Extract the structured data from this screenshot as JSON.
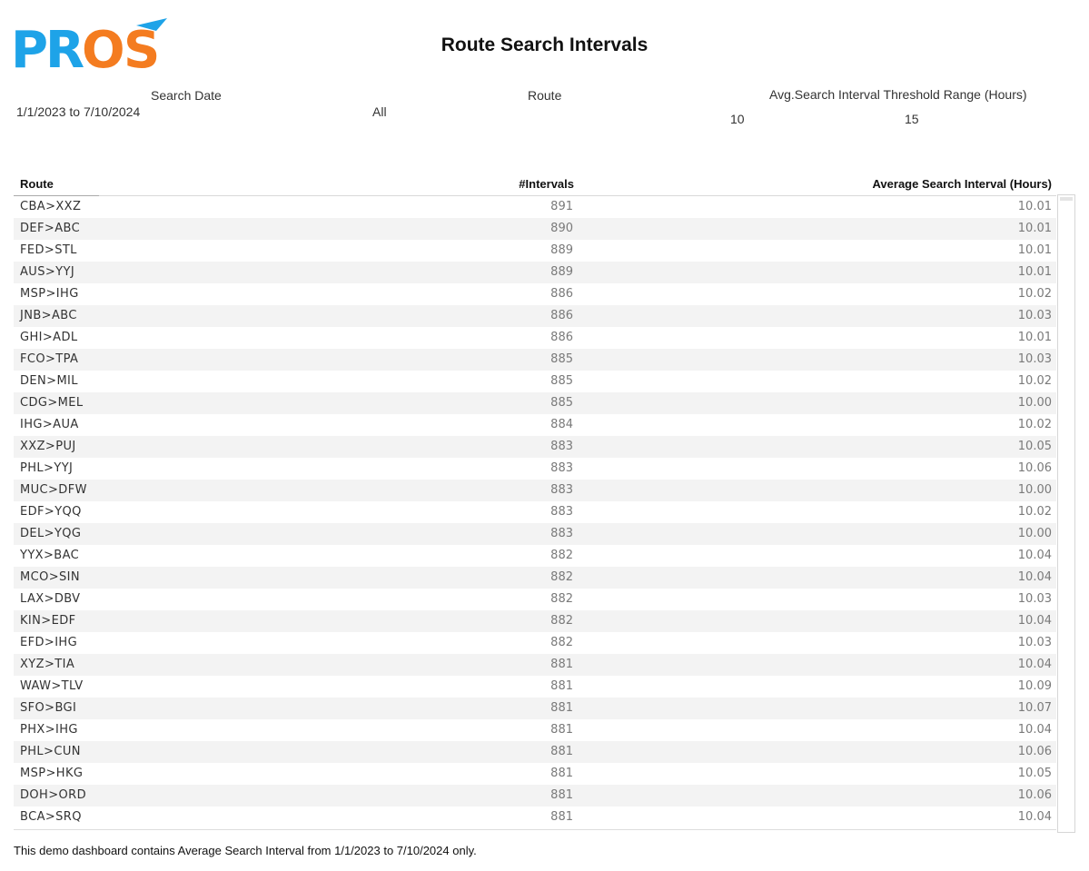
{
  "logo": {
    "text": "PROS",
    "colors": {
      "blue": "#1ea3e8",
      "orange": "#f47c20"
    }
  },
  "title": "Route Search Intervals",
  "filters": {
    "search_date": {
      "label": "Search Date",
      "value": "1/1/2023 to 7/10/2024"
    },
    "route": {
      "label": "Route",
      "value": "All"
    },
    "threshold": {
      "label": "Avg.Search Interval Threshold Range (Hours)",
      "min": "10",
      "max": "15"
    }
  },
  "table": {
    "columns": {
      "route": "Route",
      "intervals": "#Intervals",
      "avg": "Average Search Interval (Hours)"
    },
    "rows": [
      {
        "route": "CBA>XXZ",
        "intervals": "891",
        "avg": "10.01"
      },
      {
        "route": "DEF>ABC",
        "intervals": "890",
        "avg": "10.01"
      },
      {
        "route": "FED>STL",
        "intervals": "889",
        "avg": "10.01"
      },
      {
        "route": "AUS>YYJ",
        "intervals": "889",
        "avg": "10.01"
      },
      {
        "route": "MSP>IHG",
        "intervals": "886",
        "avg": "10.02"
      },
      {
        "route": "JNB>ABC",
        "intervals": "886",
        "avg": "10.03"
      },
      {
        "route": "GHI>ADL",
        "intervals": "886",
        "avg": "10.01"
      },
      {
        "route": "FCO>TPA",
        "intervals": "885",
        "avg": "10.03"
      },
      {
        "route": "DEN>MIL",
        "intervals": "885",
        "avg": "10.02"
      },
      {
        "route": "CDG>MEL",
        "intervals": "885",
        "avg": "10.00"
      },
      {
        "route": "IHG>AUA",
        "intervals": "884",
        "avg": "10.02"
      },
      {
        "route": "XXZ>PUJ",
        "intervals": "883",
        "avg": "10.05"
      },
      {
        "route": "PHL>YYJ",
        "intervals": "883",
        "avg": "10.06"
      },
      {
        "route": "MUC>DFW",
        "intervals": "883",
        "avg": "10.00"
      },
      {
        "route": "EDF>YQQ",
        "intervals": "883",
        "avg": "10.02"
      },
      {
        "route": "DEL>YQG",
        "intervals": "883",
        "avg": "10.00"
      },
      {
        "route": "YYX>BAC",
        "intervals": "882",
        "avg": "10.04"
      },
      {
        "route": "MCO>SIN",
        "intervals": "882",
        "avg": "10.04"
      },
      {
        "route": "LAX>DBV",
        "intervals": "882",
        "avg": "10.03"
      },
      {
        "route": "KIN>EDF",
        "intervals": "882",
        "avg": "10.04"
      },
      {
        "route": "EFD>IHG",
        "intervals": "882",
        "avg": "10.03"
      },
      {
        "route": "XYZ>TIA",
        "intervals": "881",
        "avg": "10.04"
      },
      {
        "route": "WAW>TLV",
        "intervals": "881",
        "avg": "10.09"
      },
      {
        "route": "SFO>BGI",
        "intervals": "881",
        "avg": "10.07"
      },
      {
        "route": "PHX>IHG",
        "intervals": "881",
        "avg": "10.04"
      },
      {
        "route": "PHL>CUN",
        "intervals": "881",
        "avg": "10.06"
      },
      {
        "route": "MSP>HKG",
        "intervals": "881",
        "avg": "10.05"
      },
      {
        "route": "DOH>ORD",
        "intervals": "881",
        "avg": "10.06"
      },
      {
        "route": "BCA>SRQ",
        "intervals": "881",
        "avg": "10.04"
      }
    ]
  },
  "footnote": "This demo dashboard contains Average Search Interval from 1/1/2023 to 7/10/2024 only."
}
